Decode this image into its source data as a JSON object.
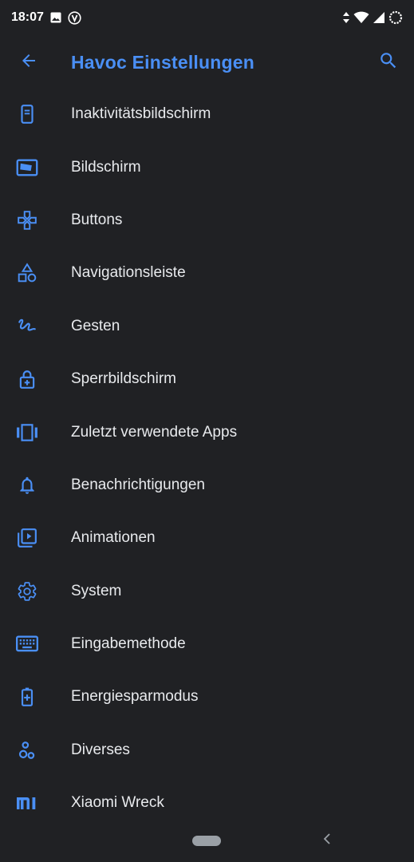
{
  "status_bar": {
    "time": "18:07",
    "icons": [
      "image-icon",
      "vpn-v-icon",
      "data-arrows-icon",
      "wifi-icon",
      "signal-icon",
      "battery-charging-icon"
    ]
  },
  "toolbar": {
    "title": "Havoc Einstellungen",
    "back_icon": "arrow-back-icon",
    "search_icon": "search-icon"
  },
  "colors": {
    "accent": "#4a8ff5",
    "background": "#202124",
    "text": "#e8eaed"
  },
  "items": [
    {
      "label": "Inaktivitätsbildschirm",
      "icon": "phone-screen-icon"
    },
    {
      "label": "Bildschirm",
      "icon": "display-icon"
    },
    {
      "label": "Buttons",
      "icon": "gamepad-icon"
    },
    {
      "label": "Navigationsleiste",
      "icon": "shapes-icon"
    },
    {
      "label": "Gesten",
      "icon": "gesture-icon"
    },
    {
      "label": "Sperrbildschirm",
      "icon": "lock-plus-icon"
    },
    {
      "label": "Zuletzt verwendete Apps",
      "icon": "carousel-icon"
    },
    {
      "label": "Benachrichtigungen",
      "icon": "bell-icon"
    },
    {
      "label": "Animationen",
      "icon": "video-library-icon"
    },
    {
      "label": "System",
      "icon": "gear-icon"
    },
    {
      "label": "Eingabemethode",
      "icon": "keyboard-icon"
    },
    {
      "label": "Energiesparmodus",
      "icon": "battery-plus-icon"
    },
    {
      "label": "Diverses",
      "icon": "bubbles-icon"
    },
    {
      "label": "Xiaomi Wreck",
      "icon": "mi-logo-icon"
    }
  ]
}
